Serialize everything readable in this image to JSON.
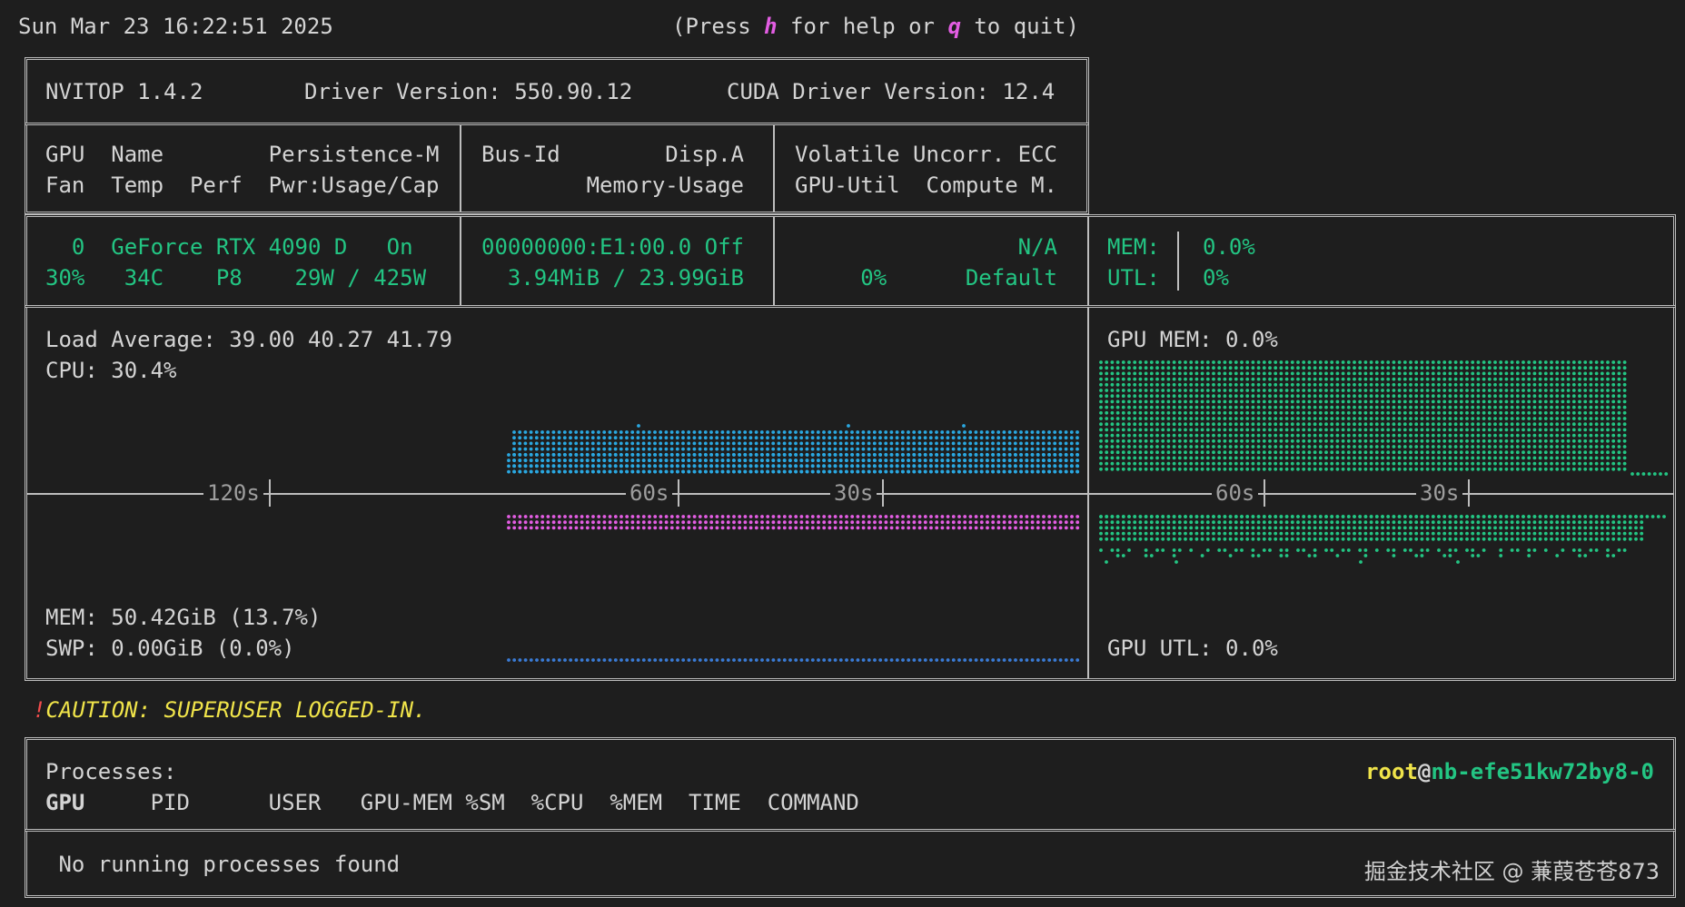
{
  "header": {
    "datetime": "Sun Mar 23 16:22:51 2025",
    "help_prefix": "(Press ",
    "help_key": "h",
    "help_mid": " for help or ",
    "quit_key": "q",
    "help_suffix": " to quit)"
  },
  "summary": {
    "nvitop": "NVITOP 1.4.2",
    "driver": "Driver Version: 550.90.12",
    "cuda": "CUDA Driver Version: 12.4"
  },
  "columns": {
    "row1": {
      "c1": "GPU  Name        Persistence-M",
      "c2": "Bus-Id        Disp.A",
      "c3": "Volatile Uncorr. ECC"
    },
    "row2": {
      "c1": "Fan  Temp  Perf  Pwr:Usage/Cap",
      "c2": "        Memory-Usage",
      "c3": "GPU-Util  Compute M."
    }
  },
  "gpu": {
    "row1": {
      "c1": "  0  GeForce RTX 4090 D   On",
      "c2": "00000000:E1:00.0 Off",
      "c3": "                 N/A",
      "c4": "MEM:",
      "c5": "0.0%"
    },
    "row2": {
      "c1": "30%   34C    P8    29W / 425W",
      "c2": "  3.94MiB / 23.99GiB",
      "c3": "     0%      Default",
      "c4": "UTL:",
      "c5": "0%"
    }
  },
  "host": {
    "load": "Load Average: 39.00 40.27 41.79",
    "cpu": "CPU: 30.4%",
    "mem": "MEM: 50.42GiB (13.7%)",
    "swp": "SWP: 0.00GiB (0.0%)",
    "axis_labels": [
      "120s",
      "60s",
      "30s"
    ]
  },
  "gpu_panel": {
    "mem": "GPU MEM: 0.0%",
    "utl": "GPU UTL: 0.0%",
    "axis_labels": [
      "60s",
      "30s"
    ]
  },
  "caution": {
    "mark": "!",
    "text": "CAUTION: SUPERUSER LOGGED-IN."
  },
  "processes": {
    "title": "Processes:",
    "user": "root",
    "at": "@",
    "host": "nb-efe51kw72by8-0",
    "header_gpu": "GPU",
    "header_rest": "     PID      USER   GPU-MEM %SM  %CPU  %MEM  TIME  COMMAND",
    "empty": " No running processes found"
  },
  "watermark": "掘金技术社区 @ 蒹葭苍苍873",
  "colors": {
    "green": "#23c583",
    "blue": "#2aa7e0",
    "magenta": "#e35de3",
    "yellow": "#f0e44a"
  }
}
